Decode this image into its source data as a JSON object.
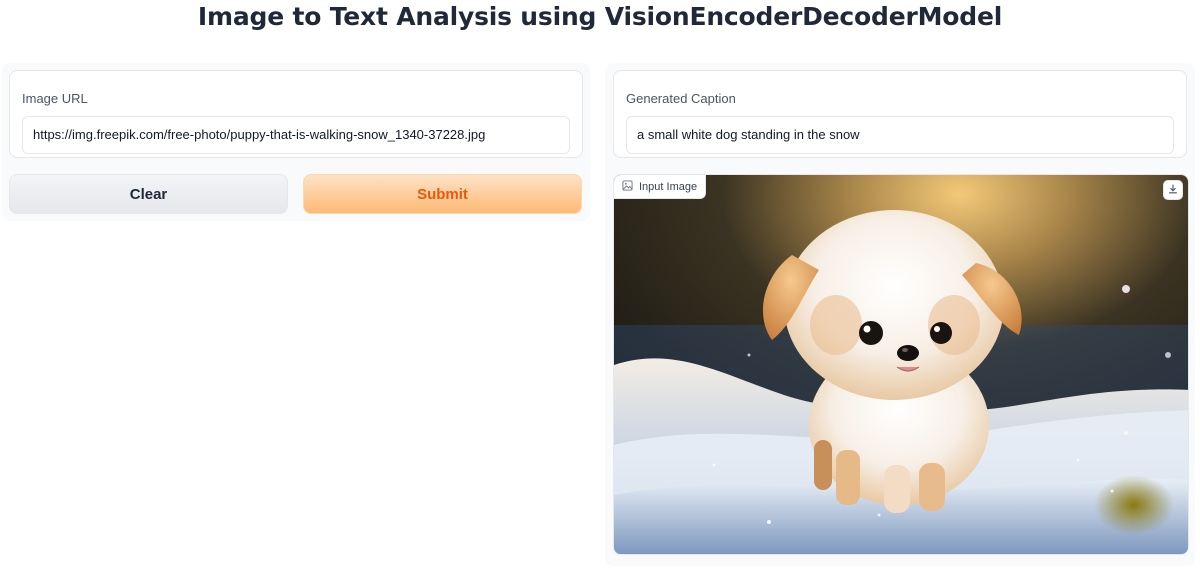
{
  "header": {
    "title": "Image to Text Analysis using VisionEncoderDecoderModel"
  },
  "input_panel": {
    "url_label": "Image URL",
    "url_value": "https://img.freepik.com/free-photo/puppy-that-is-walking-snow_1340-37228.jpg",
    "clear_label": "Clear",
    "submit_label": "Submit"
  },
  "output_panel": {
    "caption_label": "Generated Caption",
    "caption_value": "a small white dog standing in the snow",
    "image_label": "Input Image",
    "image_icon": "image-icon",
    "download_icon": "download-icon"
  },
  "colors": {
    "accent": "#ea580c",
    "submit_bg": "#fdba74",
    "clear_bg": "#e5e7eb"
  }
}
